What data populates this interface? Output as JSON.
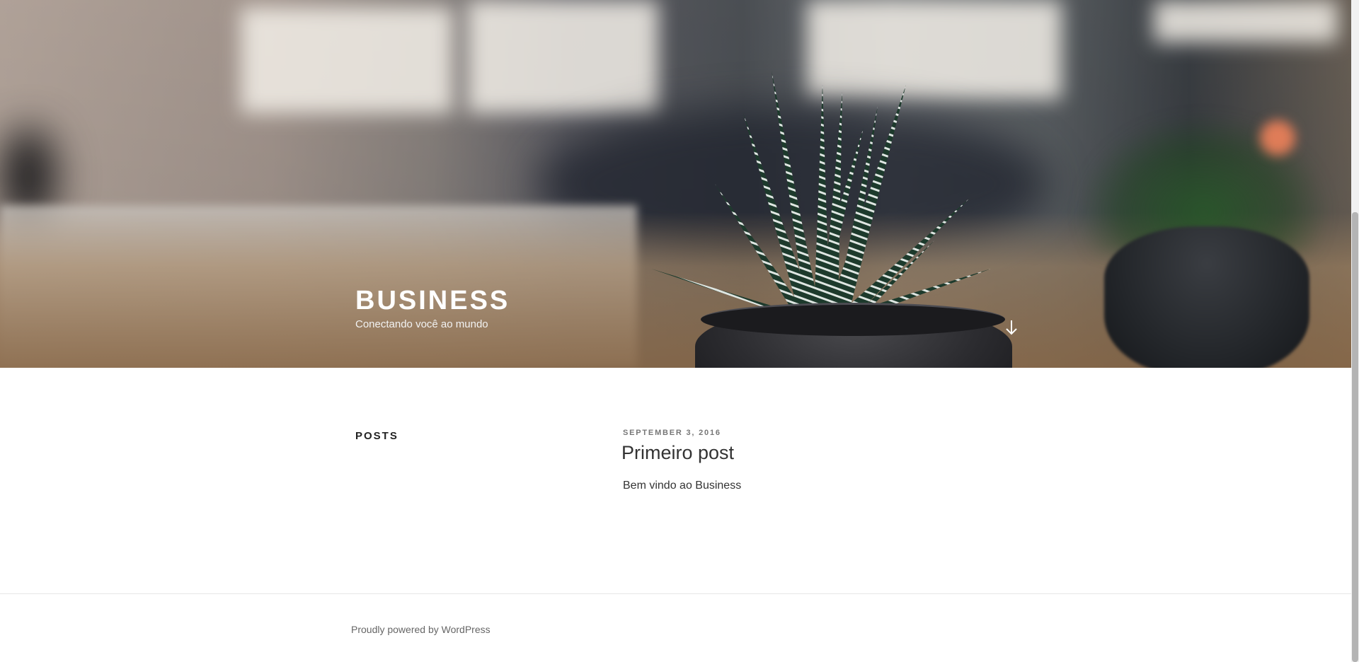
{
  "site": {
    "title": "BUSINESS",
    "description": "Conectando você ao mundo"
  },
  "header": {
    "scroll_icon": "arrow-down-icon"
  },
  "posts_section": {
    "heading": "POSTS"
  },
  "post": {
    "date": "SEPTEMBER 3, 2016",
    "title": "Primeiro post",
    "excerpt": "Bem vindo ao Business"
  },
  "footer": {
    "credit": "Proudly powered by WordPress"
  },
  "colors": {
    "text": "#333333",
    "meta": "#767676",
    "footer_text": "#666666"
  }
}
